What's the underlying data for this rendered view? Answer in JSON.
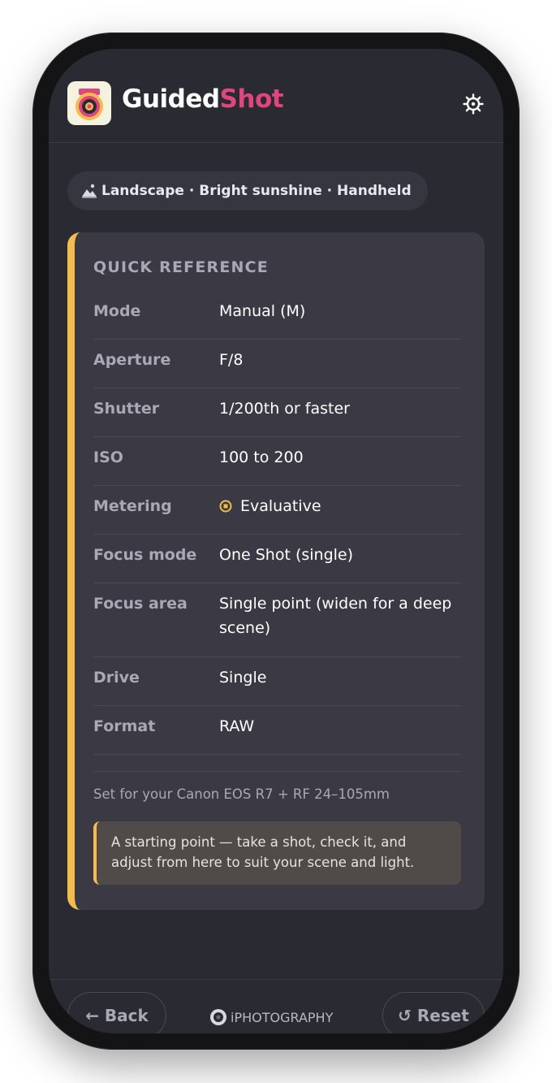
{
  "app": {
    "name_part1": "Guided",
    "name_part2": "Shot",
    "accent_color": "#e0457b",
    "logo_icon": "target-camera-icon",
    "settings_icon": "gear-icon"
  },
  "context": {
    "icon": "landscape-icon",
    "text": "Landscape · Bright sunshine · Handheld"
  },
  "card": {
    "title": "QUICK REFERENCE",
    "accent_color": "#f2bd4c",
    "rows": [
      {
        "label": "Mode",
        "value": "Manual (M)"
      },
      {
        "label": "Aperture",
        "value": "F/8"
      },
      {
        "label": "Shutter",
        "value": "1/200th or faster"
      },
      {
        "label": "ISO",
        "value": "100 to 200"
      },
      {
        "label": "Metering",
        "value": "Evaluative",
        "icon": "evaluative-metering-icon"
      },
      {
        "label": "Focus mode",
        "value": "One Shot (single)"
      },
      {
        "label": "Focus area",
        "value": "Single point (widen for a deep scene)"
      },
      {
        "label": "Drive",
        "value": "Single"
      },
      {
        "label": "Format",
        "value": "RAW"
      }
    ],
    "camera_note": "Set for your Canon EOS R7 + RF 24–105mm",
    "tip": "A starting point — take a shot, check it, and adjust from here to suit your scene and light."
  },
  "footer": {
    "back_label": "← Back",
    "brand": "iPHOTOGRAPHY",
    "reset_label": "↺ Reset"
  }
}
